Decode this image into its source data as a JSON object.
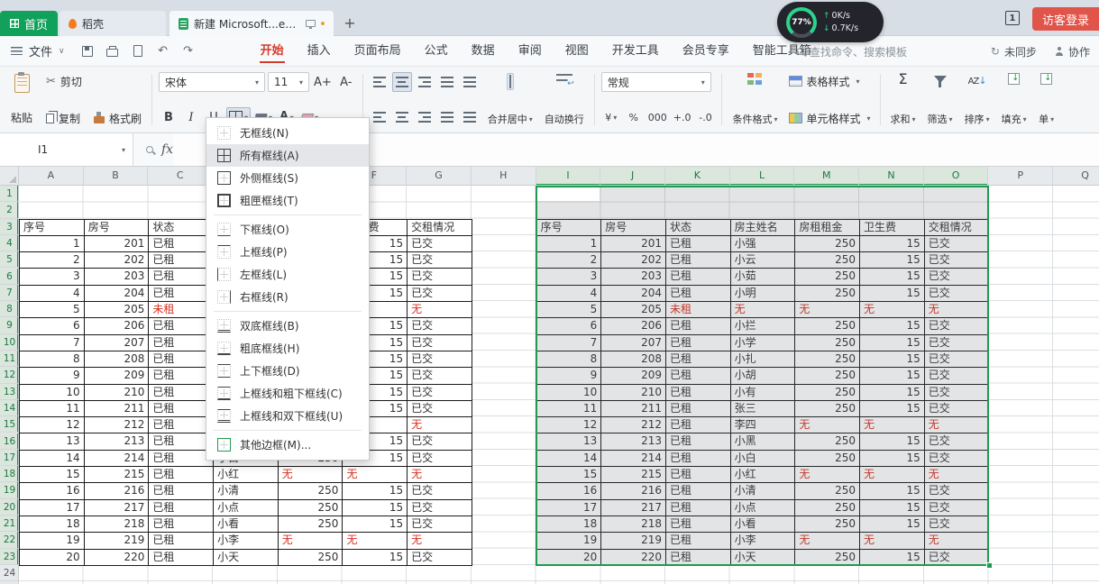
{
  "titlebar": {
    "home_tab": "首页",
    "daoke_tab": "稻壳",
    "doc_tab": "新建 Microsoft...ed Worksheet",
    "new_tab": "+",
    "window_badge": "1",
    "visitor_login": "访客登录",
    "net": {
      "percent": "77%",
      "up": "0K/s",
      "down": "0.7K/s"
    }
  },
  "menubar": {
    "file": "文件",
    "tabs": [
      "开始",
      "插入",
      "页面布局",
      "公式",
      "数据",
      "审阅",
      "视图",
      "开发工具",
      "会员专享",
      "智能工具箱"
    ],
    "active_tab": "开始",
    "search_placeholder": "查找命令、搜索模板",
    "right": [
      "未同步",
      "协作"
    ]
  },
  "toolbar": {
    "paste": "粘贴",
    "cut": "剪切",
    "copy": "复制",
    "format_painter": "格式刷",
    "font_name": "宋体",
    "font_size": "11",
    "grow_font": "A+",
    "shrink_font": "A-",
    "bold": "B",
    "italic": "I",
    "underline": "U",
    "merge_center": "合并居中",
    "wrap_text": "自动换行",
    "number_format": "常规",
    "number_icons": [
      "¥",
      "%",
      "000",
      "+.0",
      "-.0"
    ],
    "conditional_format": "条件格式",
    "table_style": "表格样式",
    "cell_style": "单元格样式",
    "sum": "求和",
    "filter": "筛选",
    "sort": "排序",
    "fill": "填充",
    "more_cut": "单"
  },
  "formula_bar": {
    "cell_ref": "I1",
    "fx": "fx"
  },
  "border_menu": {
    "items": [
      {
        "label": "无框线(N)",
        "icon": "border-none"
      },
      {
        "label": "所有框线(A)",
        "icon": "border-all",
        "selected": true
      },
      {
        "label": "外侧框线(S)",
        "icon": "border-outside"
      },
      {
        "label": "粗匣框线(T)",
        "icon": "border-thick-box"
      },
      {
        "divider": true
      },
      {
        "label": "下框线(O)",
        "icon": "border-bottom"
      },
      {
        "label": "上框线(P)",
        "icon": "border-top"
      },
      {
        "label": "左框线(L)",
        "icon": "border-left"
      },
      {
        "label": "右框线(R)",
        "icon": "border-right"
      },
      {
        "divider": true
      },
      {
        "label": "双底框线(B)",
        "icon": "border-double-bottom"
      },
      {
        "label": "粗底框线(H)",
        "icon": "border-thick-bottom"
      },
      {
        "label": "上下框线(D)",
        "icon": "border-top-bottom"
      },
      {
        "label": "上框线和粗下框线(C)",
        "icon": "border-top-thick-bottom"
      },
      {
        "label": "上框线和双下框线(U)",
        "icon": "border-top-double-bottom"
      },
      {
        "divider": true
      },
      {
        "label": "其他边框(M)...",
        "icon": "border-more"
      }
    ]
  },
  "sheet": {
    "columns": [
      "A",
      "B",
      "C",
      "D",
      "E",
      "F",
      "G",
      "H",
      "I",
      "J",
      "K",
      "L",
      "M",
      "N",
      "O",
      "P",
      "Q"
    ],
    "selected_columns": [
      "I",
      "J",
      "K",
      "L",
      "M",
      "N",
      "O"
    ],
    "row_count": 24,
    "selected_rows_through": 23,
    "selection": {
      "range": "I1:O23",
      "active_cell": "I1"
    },
    "colors": {
      "accent_green": "#1f9a50",
      "alert_red": "#d92f1f"
    },
    "table": {
      "headers": [
        "序号",
        "房号",
        "状态",
        "房主姓名",
        "房租租金",
        "卫生费",
        "交租情况"
      ],
      "rows": [
        [
          "1",
          "201",
          "已租",
          "小强",
          "250",
          "15",
          "已交"
        ],
        [
          "2",
          "202",
          "已租",
          "小云",
          "250",
          "15",
          "已交"
        ],
        [
          "3",
          "203",
          "已租",
          "小茹",
          "250",
          "15",
          "已交"
        ],
        [
          "4",
          "204",
          "已租",
          "小明",
          "250",
          "15",
          "已交"
        ],
        [
          "5",
          "205",
          "未租",
          "无",
          "无",
          "无",
          "无"
        ],
        [
          "6",
          "206",
          "已租",
          "小拦",
          "250",
          "15",
          "已交"
        ],
        [
          "7",
          "207",
          "已租",
          "小学",
          "250",
          "15",
          "已交"
        ],
        [
          "8",
          "208",
          "已租",
          "小扎",
          "250",
          "15",
          "已交"
        ],
        [
          "9",
          "209",
          "已租",
          "小胡",
          "250",
          "15",
          "已交"
        ],
        [
          "10",
          "210",
          "已租",
          "小有",
          "250",
          "15",
          "已交"
        ],
        [
          "11",
          "211",
          "已租",
          "张三",
          "250",
          "15",
          "已交"
        ],
        [
          "12",
          "212",
          "已租",
          "李四",
          "无",
          "无",
          "无"
        ],
        [
          "13",
          "213",
          "已租",
          "小黑",
          "250",
          "15",
          "已交"
        ],
        [
          "14",
          "214",
          "已租",
          "小白",
          "250",
          "15",
          "已交"
        ],
        [
          "15",
          "215",
          "已租",
          "小红",
          "无",
          "无",
          "无"
        ],
        [
          "16",
          "216",
          "已租",
          "小清",
          "250",
          "15",
          "已交"
        ],
        [
          "17",
          "217",
          "已租",
          "小点",
          "250",
          "15",
          "已交"
        ],
        [
          "18",
          "218",
          "已租",
          "小看",
          "250",
          "15",
          "已交"
        ],
        [
          "19",
          "219",
          "已租",
          "小李",
          "无",
          "无",
          "无"
        ],
        [
          "20",
          "220",
          "已租",
          "小天",
          "250",
          "15",
          "已交"
        ]
      ]
    }
  }
}
